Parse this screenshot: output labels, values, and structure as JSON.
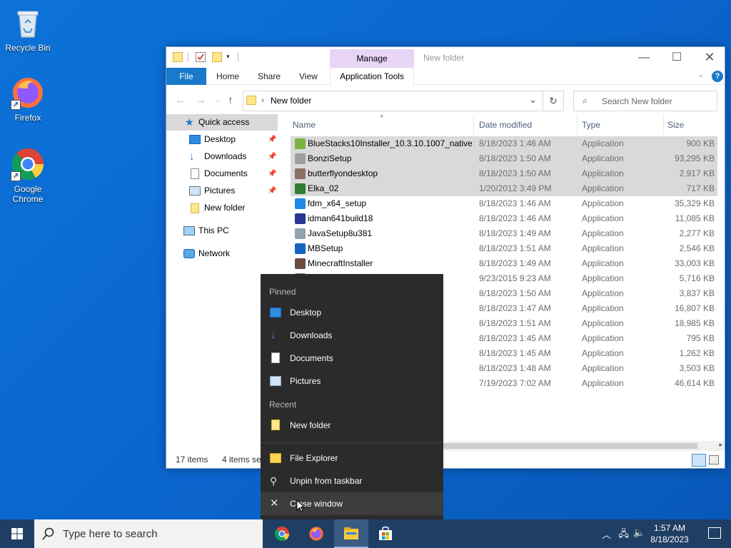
{
  "desktop": {
    "icons": [
      {
        "label": "Recycle Bin"
      },
      {
        "label": "Firefox"
      },
      {
        "label": "Google Chrome"
      }
    ]
  },
  "window": {
    "title": "New folder",
    "manage_label": "Manage",
    "ribbon_tabs": [
      "File",
      "Home",
      "Share",
      "View",
      "Application Tools"
    ],
    "address": "New folder",
    "search_placeholder": "Search New folder",
    "columns": [
      "Name",
      "Date modified",
      "Type",
      "Size"
    ],
    "nav": {
      "quick_access": "Quick access",
      "pinned": [
        "Desktop",
        "Downloads",
        "Documents",
        "Pictures"
      ],
      "new_folder": "New folder",
      "this_pc": "This PC",
      "network": "Network"
    },
    "files": [
      {
        "name": "BlueStacks10Installer_10.3.10.1007_native...",
        "date": "8/18/2023 1:46 AM",
        "type": "Application",
        "size": "900 KB",
        "selected": true,
        "color": "#7cb342"
      },
      {
        "name": "BonziSetup",
        "date": "8/18/2023 1:50 AM",
        "type": "Application",
        "size": "93,295 KB",
        "selected": true,
        "color": "#9e9e9e"
      },
      {
        "name": "butterflyondesktop",
        "date": "8/18/2023 1:50 AM",
        "type": "Application",
        "size": "2,917 KB",
        "selected": true,
        "color": "#8d6e63"
      },
      {
        "name": "Elka_02",
        "date": "1/20/2012 3:49 PM",
        "type": "Application",
        "size": "717 KB",
        "selected": true,
        "color": "#2e7d32"
      },
      {
        "name": "fdm_x64_setup",
        "date": "8/18/2023 1:46 AM",
        "type": "Application",
        "size": "35,329 KB",
        "selected": false,
        "color": "#1e88e5"
      },
      {
        "name": "idman641build18",
        "date": "8/18/2023 1:46 AM",
        "type": "Application",
        "size": "11,085 KB",
        "selected": false,
        "color": "#283593"
      },
      {
        "name": "JavaSetup8u381",
        "date": "8/18/2023 1:49 AM",
        "type": "Application",
        "size": "2,277 KB",
        "selected": false,
        "color": "#90a4ae"
      },
      {
        "name": "MBSetup",
        "date": "8/18/2023 1:51 AM",
        "type": "Application",
        "size": "2,546 KB",
        "selected": false,
        "color": "#1565c0"
      },
      {
        "name": "MinecraftInstaller",
        "date": "8/18/2023 1:49 AM",
        "type": "Application",
        "size": "33,003 KB",
        "selected": false,
        "color": "#6d4c41"
      },
      {
        "name": "",
        "date": "9/23/2015 9:23 AM",
        "type": "Application",
        "size": "5,716 KB",
        "selected": false,
        "color": "#757575"
      },
      {
        "name": "",
        "date": "8/18/2023 1:50 AM",
        "type": "Application",
        "size": "3,837 KB",
        "selected": false,
        "color": "#757575"
      },
      {
        "name": "",
        "date": "8/18/2023 1:47 AM",
        "type": "Application",
        "size": "16,807 KB",
        "selected": false,
        "color": "#757575"
      },
      {
        "name": "",
        "date": "8/18/2023 1:51 AM",
        "type": "Application",
        "size": "18,985 KB",
        "selected": false,
        "color": "#757575"
      },
      {
        "name": "",
        "date": "8/18/2023 1:45 AM",
        "type": "Application",
        "size": "795 KB",
        "selected": false,
        "color": "#757575"
      },
      {
        "name": "",
        "date": "8/18/2023 1:45 AM",
        "type": "Application",
        "size": "1,262 KB",
        "selected": false,
        "color": "#757575"
      },
      {
        "name": "",
        "date": "8/18/2023 1:48 AM",
        "type": "Application",
        "size": "3,503 KB",
        "selected": false,
        "color": "#757575"
      },
      {
        "name": "",
        "date": "7/19/2023 7:02 AM",
        "type": "Application",
        "size": "46,614 KB",
        "selected": false,
        "color": "#757575"
      }
    ],
    "status_items": "17 items",
    "status_selected": "4 items se"
  },
  "jumplist": {
    "pinned_header": "Pinned",
    "pinned": [
      "Desktop",
      "Downloads",
      "Documents",
      "Pictures"
    ],
    "recent_header": "Recent",
    "recent": [
      "New folder"
    ],
    "actions": [
      "File Explorer",
      "Unpin from taskbar",
      "Close window"
    ]
  },
  "taskbar": {
    "search_placeholder": "Type here to search",
    "time": "1:57 AM",
    "date": "8/18/2023"
  }
}
